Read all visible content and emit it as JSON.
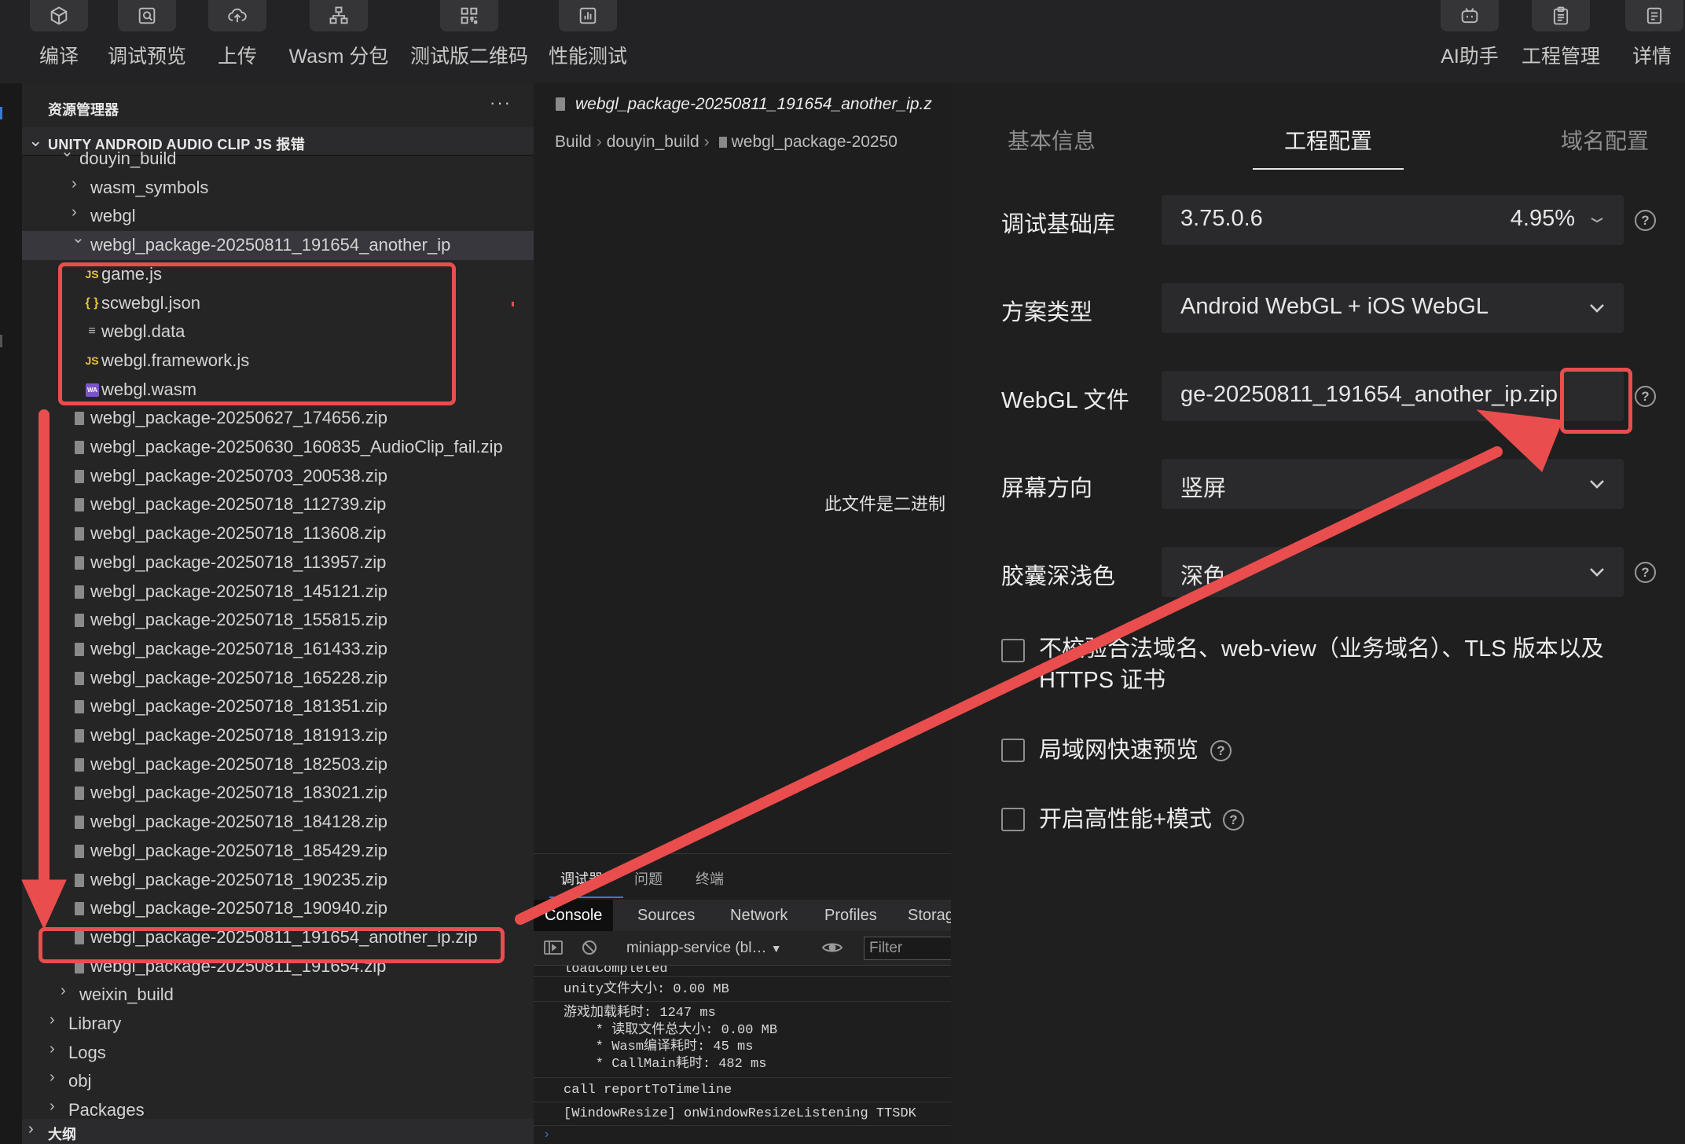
{
  "toolbar": {
    "left": [
      {
        "label": "编译",
        "icon": "cube-icon"
      },
      {
        "label": "调试预览",
        "icon": "preview-search-icon"
      },
      {
        "label": "上传",
        "icon": "cloud-upload-icon"
      },
      {
        "label": "Wasm 分包",
        "icon": "split-package-icon"
      },
      {
        "label": "测试版二维码",
        "icon": "qrcode-icon"
      },
      {
        "label": "性能测试",
        "icon": "bar-chart-icon"
      }
    ],
    "right": [
      {
        "label": "AI助手",
        "icon": "robot-icon"
      },
      {
        "label": "工程管理",
        "icon": "clipboard-icon"
      },
      {
        "label": "详情",
        "icon": "document-icon"
      }
    ]
  },
  "explorer": {
    "title": "资源管理器",
    "more": "···",
    "project": "UNITY ANDROID AUDIO CLIP JS 报错",
    "outline": "大纲",
    "rows": [
      {
        "label": "douyin_build",
        "indent": 1,
        "type": "folder-open"
      },
      {
        "label": "wasm_symbols",
        "indent": 2,
        "type": "folder"
      },
      {
        "label": "webgl",
        "indent": 2,
        "type": "folder"
      },
      {
        "label": "webgl_package-20250811_191654_another_ip",
        "indent": 2,
        "type": "folder-open",
        "selected": true
      },
      {
        "label": "game.js",
        "indent": 3,
        "type": "js"
      },
      {
        "label": "scwebgl.json",
        "indent": 3,
        "type": "json"
      },
      {
        "label": "webgl.data",
        "indent": 3,
        "type": "data"
      },
      {
        "label": "webgl.framework.js",
        "indent": 3,
        "type": "js"
      },
      {
        "label": "webgl.wasm",
        "indent": 3,
        "type": "wasm"
      },
      {
        "label": "webgl_package-20250627_174656.zip",
        "indent": 2,
        "type": "zip"
      },
      {
        "label": "webgl_package-20250630_160835_AudioClip_fail.zip",
        "indent": 2,
        "type": "zip"
      },
      {
        "label": "webgl_package-20250703_200538.zip",
        "indent": 2,
        "type": "zip"
      },
      {
        "label": "webgl_package-20250718_112739.zip",
        "indent": 2,
        "type": "zip"
      },
      {
        "label": "webgl_package-20250718_113608.zip",
        "indent": 2,
        "type": "zip"
      },
      {
        "label": "webgl_package-20250718_113957.zip",
        "indent": 2,
        "type": "zip"
      },
      {
        "label": "webgl_package-20250718_145121.zip",
        "indent": 2,
        "type": "zip"
      },
      {
        "label": "webgl_package-20250718_155815.zip",
        "indent": 2,
        "type": "zip"
      },
      {
        "label": "webgl_package-20250718_161433.zip",
        "indent": 2,
        "type": "zip"
      },
      {
        "label": "webgl_package-20250718_165228.zip",
        "indent": 2,
        "type": "zip"
      },
      {
        "label": "webgl_package-20250718_181351.zip",
        "indent": 2,
        "type": "zip"
      },
      {
        "label": "webgl_package-20250718_181913.zip",
        "indent": 2,
        "type": "zip"
      },
      {
        "label": "webgl_package-20250718_182503.zip",
        "indent": 2,
        "type": "zip"
      },
      {
        "label": "webgl_package-20250718_183021.zip",
        "indent": 2,
        "type": "zip"
      },
      {
        "label": "webgl_package-20250718_184128.zip",
        "indent": 2,
        "type": "zip"
      },
      {
        "label": "webgl_package-20250718_185429.zip",
        "indent": 2,
        "type": "zip"
      },
      {
        "label": "webgl_package-20250718_190235.zip",
        "indent": 2,
        "type": "zip"
      },
      {
        "label": "webgl_package-20250718_190940.zip",
        "indent": 2,
        "type": "zip"
      },
      {
        "label": "webgl_package-20250811_191654_another_ip.zip",
        "indent": 2,
        "type": "zip"
      },
      {
        "label": "webgl_package-20250811_191654.zip",
        "indent": 2,
        "type": "zip"
      },
      {
        "label": "weixin_build",
        "indent": 1,
        "type": "folder"
      },
      {
        "label": "Library",
        "indent": 0,
        "type": "folder"
      },
      {
        "label": "Logs",
        "indent": 0,
        "type": "folder"
      },
      {
        "label": "obj",
        "indent": 0,
        "type": "folder"
      },
      {
        "label": "Packages",
        "indent": 0,
        "type": "folder"
      }
    ]
  },
  "editor": {
    "tab_title": "webgl_package-20250811_191654_another_ip.z",
    "breadcrumb": [
      "Build",
      "douyin_build",
      "webgl_package-20250"
    ],
    "binary_notice": "此文件是二进制"
  },
  "debugger": {
    "panel_tabs": [
      "调试器",
      "问题",
      "终端"
    ],
    "devtools_tabs": [
      "Console",
      "Sources",
      "Network",
      "Profiles",
      "Storage"
    ],
    "context": "miniapp-service (bl…",
    "filter_placeholder": "Filter",
    "logs": [
      "loadCompleted",
      "unity文件大小: 0.00 MB",
      "游戏加载耗时: 1247 ms\n    * 读取文件总大小: 0.00 MB\n    * Wasm编译耗时: 45 ms\n    * CallMain耗时: 482 ms",
      "call reportToTimeline",
      "[WindowResize] onWindowResizeListening TTSDK"
    ]
  },
  "settings": {
    "tabs": [
      "基本信息",
      "工程配置",
      "域名配置"
    ],
    "fields": {
      "lib_label": "调试基础库",
      "lib_value": "3.75.0.6",
      "lib_percent": "4.95%",
      "plan_label": "方案类型",
      "plan_value": "Android WebGL + iOS WebGL",
      "webgl_label": "WebGL 文件",
      "webgl_value": "ge-20250811_191654_another_ip.zip",
      "orient_label": "屏幕方向",
      "orient_value": "竖屏",
      "capsule_label": "胶囊深浅色",
      "capsule_value": "深色"
    },
    "checkboxes": {
      "no_verify": "不校验合法域名、web-view（业务域名）、TLS 版本以及 HTTPS 证书",
      "lan_preview": "局域网快速预览",
      "high_perf": "开启高性能+模式"
    },
    "help_mark": "?"
  },
  "colors": {
    "annotation": "#ea4d4d",
    "accent": "#3a78d6",
    "js_icon": "#e8c33a",
    "wasm_icon": "#7b55c7"
  }
}
